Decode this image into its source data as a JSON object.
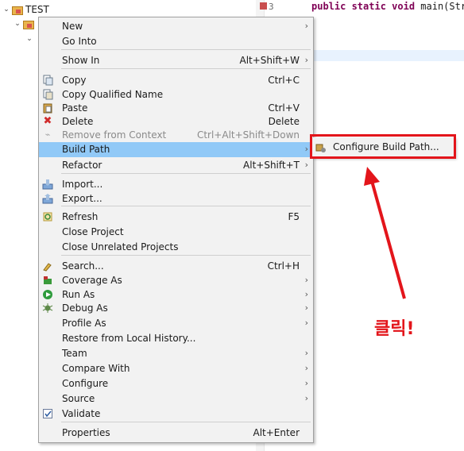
{
  "tree": {
    "project_name": "TEST"
  },
  "editor": {
    "line_number": "3",
    "code_keywords": "public static void",
    "code_rest": " main(Str",
    "brace": "}"
  },
  "context_menu": {
    "items": [
      {
        "label": "New",
        "shortcut": "",
        "submenu": true,
        "icon": ""
      },
      {
        "label": "Go Into",
        "shortcut": "",
        "submenu": false,
        "icon": ""
      },
      {
        "label": "Show In",
        "shortcut": "Alt+Shift+W",
        "submenu": true,
        "icon": ""
      },
      {
        "label": "Copy",
        "shortcut": "Ctrl+C",
        "submenu": false,
        "icon": "copy-icon"
      },
      {
        "label": "Copy Qualified Name",
        "shortcut": "",
        "submenu": false,
        "icon": "copy-qualified-icon"
      },
      {
        "label": "Paste",
        "shortcut": "Ctrl+V",
        "submenu": false,
        "icon": "paste-icon"
      },
      {
        "label": "Delete",
        "shortcut": "Delete",
        "submenu": false,
        "icon": "delete-icon"
      },
      {
        "label": "Remove from Context",
        "shortcut": "Ctrl+Alt+Shift+Down",
        "submenu": false,
        "icon": "remove-context-icon",
        "disabled": true
      },
      {
        "label": "Build Path",
        "shortcut": "",
        "submenu": true,
        "icon": "",
        "highlighted": true
      },
      {
        "label": "Refactor",
        "shortcut": "Alt+Shift+T",
        "submenu": true,
        "icon": ""
      },
      {
        "label": "Import...",
        "shortcut": "",
        "submenu": false,
        "icon": "import-icon"
      },
      {
        "label": "Export...",
        "shortcut": "",
        "submenu": false,
        "icon": "export-icon"
      },
      {
        "label": "Refresh",
        "shortcut": "F5",
        "submenu": false,
        "icon": "refresh-icon"
      },
      {
        "label": "Close Project",
        "shortcut": "",
        "submenu": false,
        "icon": ""
      },
      {
        "label": "Close Unrelated Projects",
        "shortcut": "",
        "submenu": false,
        "icon": ""
      },
      {
        "label": "Search...",
        "shortcut": "Ctrl+H",
        "submenu": false,
        "icon": "search-icon"
      },
      {
        "label": "Coverage As",
        "shortcut": "",
        "submenu": true,
        "icon": "coverage-icon"
      },
      {
        "label": "Run As",
        "shortcut": "",
        "submenu": true,
        "icon": "run-icon"
      },
      {
        "label": "Debug As",
        "shortcut": "",
        "submenu": true,
        "icon": "debug-icon"
      },
      {
        "label": "Profile As",
        "shortcut": "",
        "submenu": true,
        "icon": ""
      },
      {
        "label": "Restore from Local History...",
        "shortcut": "",
        "submenu": false,
        "icon": ""
      },
      {
        "label": "Team",
        "shortcut": "",
        "submenu": true,
        "icon": ""
      },
      {
        "label": "Compare With",
        "shortcut": "",
        "submenu": true,
        "icon": ""
      },
      {
        "label": "Configure",
        "shortcut": "",
        "submenu": true,
        "icon": ""
      },
      {
        "label": "Source",
        "shortcut": "",
        "submenu": true,
        "icon": ""
      },
      {
        "label": "Validate",
        "shortcut": "",
        "submenu": false,
        "icon": "validate-checkbox-icon"
      },
      {
        "label": "Properties",
        "shortcut": "Alt+Enter",
        "submenu": false,
        "icon": ""
      }
    ]
  },
  "submenu": {
    "label": "Configure Build Path..."
  },
  "annotation": {
    "text": "클릭!",
    "color": "#e3151b"
  },
  "colors": {
    "highlight": "#91c9f7",
    "menu_bg": "#f2f2f2"
  }
}
